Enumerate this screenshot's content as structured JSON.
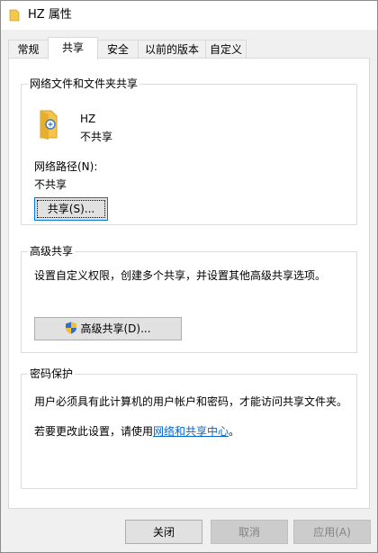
{
  "window": {
    "title": "HZ 属性",
    "folder_color": "#e8b923"
  },
  "tabs": [
    {
      "label": "常规",
      "active": false
    },
    {
      "label": "共享",
      "active": true
    },
    {
      "label": "安全",
      "active": false
    },
    {
      "label": "以前的版本",
      "active": false
    },
    {
      "label": "自定义",
      "active": false
    }
  ],
  "network_sharing": {
    "group_title": "网络文件和文件夹共享",
    "folder_name": "HZ",
    "folder_status": "不共享",
    "path_label": "网络路径(N):",
    "path_value": "不共享",
    "share_button": "共享(S)..."
  },
  "advanced_sharing": {
    "group_title": "高级共享",
    "description": "设置自定义权限，创建多个共享，并设置其他高级共享选项。",
    "button": "高级共享(D)..."
  },
  "password_protection": {
    "group_title": "密码保护",
    "description": "用户必须具有此计算机的用户帐户和密码，才能访问共享文件夹。",
    "change_prefix": "若要更改此设置，请使用",
    "link_text": "网络和共享中心",
    "change_suffix": "。"
  },
  "footer": {
    "close_button": "关闭",
    "cancel_button": "取消",
    "apply_button": "应用(A)"
  },
  "colors": {
    "link": "#0066cc",
    "focus_border": "#0078d7"
  }
}
